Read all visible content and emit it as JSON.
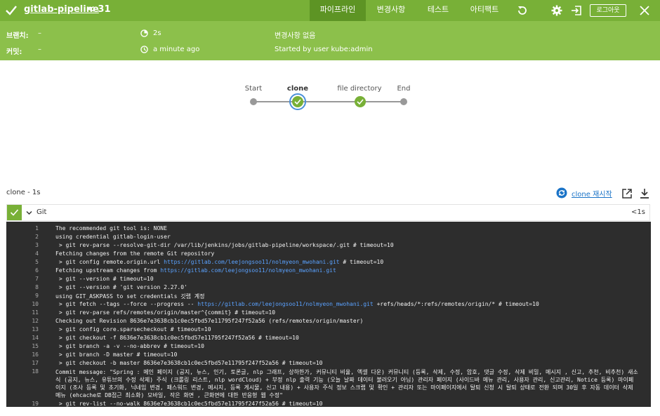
{
  "header": {
    "title": "gitlab-pipeline",
    "run_number": "< 31",
    "tabs": [
      {
        "label": "파이프라인",
        "active": true
      },
      {
        "label": "변경사항",
        "active": false
      },
      {
        "label": "테스트",
        "active": false
      },
      {
        "label": "아티팩트",
        "active": false
      }
    ],
    "logout_label": "로그아웃",
    "colors": {
      "bar": "#78b037",
      "active_tab": "#5d9424",
      "info": "#8cc04b"
    }
  },
  "info": {
    "branch_label": "브랜치:",
    "branch_value": "–",
    "commit_label": "커밋:",
    "commit_value": "–",
    "duration": "2s",
    "started_ago": "a minute ago",
    "changes": "변경사항 없음",
    "started_by": "Started by user kube:admin"
  },
  "stages": [
    {
      "label": "Start",
      "status": "start"
    },
    {
      "label": "clone",
      "status": "success-selected"
    },
    {
      "label": "file directory",
      "status": "success"
    },
    {
      "label": "End",
      "status": "end"
    }
  ],
  "section": {
    "title": "clone - 1s",
    "restart_label": "clone 재시작"
  },
  "step": {
    "name": "Git",
    "duration": "<1s"
  },
  "log_lines": [
    {
      "no": "1",
      "text": "The recommended git tool is: NONE"
    },
    {
      "no": "2",
      "text": "using credential gitlab-login-user"
    },
    {
      "no": "3",
      "text": " > git rev-parse --resolve-git-dir /var/lib/jenkins/jobs/gitlab-pipeline/workspace/.git # timeout=10"
    },
    {
      "no": "4",
      "text": "Fetching changes from the remote Git repository"
    },
    {
      "no": "5",
      "pre": " > git config remote.origin.url ",
      "url": "https://gitlab.com/leejongsoo11/nolmyeon_mwohani.git",
      "post": " # timeout=10"
    },
    {
      "no": "6",
      "pre": "Fetching upstream changes from ",
      "url": "https://gitlab.com/leejongsoo11/nolmyeon_mwohani.git",
      "post": ""
    },
    {
      "no": "7",
      "text": " > git --version # timeout=10"
    },
    {
      "no": "8",
      "text": " > git --version # 'git version 2.27.0'"
    },
    {
      "no": "9",
      "text": "using GIT_ASKPASS to set credentials 깃랩 계정"
    },
    {
      "no": "10",
      "pre": " > git fetch --tags --force --progress -- ",
      "url": "https://gitlab.com/leejongsoo11/nolmyeon_mwohani.git",
      "post": " +refs/heads/*:refs/remotes/origin/* # timeout=10"
    },
    {
      "no": "11",
      "text": " > git rev-parse refs/remotes/origin/master^{commit} # timeout=10"
    },
    {
      "no": "12",
      "text": "Checking out Revision 8636e7e3638cb1c0ec5fbd57e11795f247f52a56 (refs/remotes/origin/master)"
    },
    {
      "no": "13",
      "text": " > git config core.sparsecheckout # timeout=10"
    },
    {
      "no": "14",
      "text": " > git checkout -f 8636e7e3638cb1c0ec5fbd57e11795f247f52a56 # timeout=10"
    },
    {
      "no": "15",
      "text": " > git branch -a -v --no-abbrev # timeout=10"
    },
    {
      "no": "16",
      "text": " > git branch -D master # timeout=10"
    },
    {
      "no": "17",
      "text": " > git checkout -b master 8636e7e3638cb1c0ec5fbd57e11795f247f52a56 # timeout=10"
    },
    {
      "no": "18",
      "text": "Commit message: \"Spring : 메인 페이지 (공지, 뉴스, 인기, 토론글, nlp 그래프, 상하한가, 커뮤니티 비율, 엑셀 다운) 커뮤니티 (등록, 삭제, 수정, 암호, 댓글 수정, 삭제 비밀, 메시지 , 신고, 추천, 비추천) 새소식 (공지, 뉴스, 유튜브의 수정 삭제) 주식 (크롤링 리스트, nlp wordCloud) + 부정 nlp 출력 기능 (오늘 날짜 데이터 불러오기 아님) 관리자 페이지 (사이드바 메뉴 관리, 사용자 관리, 신고관리, Notice 등록) 마이페이지 (조사 등록 및 초기화, 닉네임 변경, 패스워드 변경, 메시지, 등록 게시물, 신고 내용) + 사용자 주식 정보 스크랩 및 확인 + 관리자 또는 마이페이지에서 탈퇴 신청 시 탈퇴 상태로 전환 되며 30일 후 자동 데이터 삭제 메뉴 (ehcache로 DB접근 최소화) 모바일, 작은 화면 , 큰화면에 대한 반응형 웹 수정\"",
      "wrap": true
    },
    {
      "no": "19",
      "text": " > git rev-list --no-walk 8636e7e3638cb1c0ec5fbd57e11795f247f52a56 # timeout=10"
    }
  ]
}
